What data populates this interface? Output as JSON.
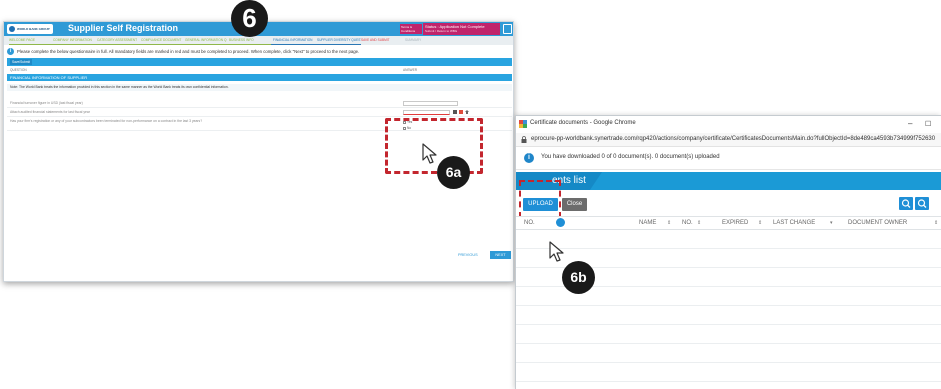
{
  "callouts": {
    "step_badge": "6",
    "label_a": "6a",
    "label_b": "6b"
  },
  "left_window": {
    "logo_text": "WORLD BANK GROUP",
    "title": "Supplier Self Registration",
    "terms_label": "Terms & Conditions",
    "status_text": "Status : Application Not Complete",
    "status_subtext": "Submit / Return to WBG",
    "steps": [
      {
        "label": "Welcome Page",
        "state": "done"
      },
      {
        "label": "Company Information",
        "state": "done"
      },
      {
        "label": "Category Assessment",
        "state": "done"
      },
      {
        "label": "Compliance Document",
        "state": "done"
      },
      {
        "label": "General Information Q",
        "state": "done"
      },
      {
        "label": "Business Info",
        "state": "done"
      },
      {
        "label": "Financial Information",
        "state": "active"
      },
      {
        "label": "Supplier Diversity Questionnaire",
        "state": "active"
      },
      {
        "label": "Save and Submit",
        "state": "red"
      },
      {
        "label": "Summary",
        "state": "gray"
      }
    ],
    "info_text": "Please complete the below questionnaire in full. All mandatory fields are marked in red and must be completed to proceed. When complete, click \"Next\" to proceed to the next page.",
    "tab_label": "Save/Submit",
    "col_question": "QUESTION",
    "col_answer": "ANSWER",
    "section_title": "FINANCIAL INFORMATION OF SUPPLIER",
    "note": "Note: The World Bank treats the information provided in this section in the same manner as the World Bank treats its own confidential information.",
    "questions": [
      "Financial turnover figure in USD (last fiscal year)",
      "Attach audited financial statements for last fiscal year",
      "Has your firm's registration or any of your subcontractors been terminated for non-performance on a contract in the last 3 years?"
    ],
    "radio_options": [
      "Yes",
      "No"
    ],
    "previous_label": "PREVIOUS",
    "next_label": "NEXT"
  },
  "right_window": {
    "window_title": "Certificate documents - Google Chrome",
    "url": "eprocure-pp-worldbank.synertrade.com/rqp420/actions/company/certificate/CertificatesDocumentsMain.do?fullObjectId=8de489ca4593b734999f752630",
    "download_info": "You have downloaded 0 of 0 document(s). 0 document(s) uploaded",
    "list_tab_label": "ents list",
    "upload_label": "UPLOAD",
    "close_label": "Close",
    "columns": [
      "NO.",
      "NAME",
      "NO.",
      "EXPIRED",
      "LAST CHANGE",
      "DOCUMENT OWNER"
    ]
  },
  "colors": {
    "brand_blue": "#2f9ad6",
    "highlight_red": "#c3262e",
    "status_magenta": "#c0246b",
    "badge_black": "#1a1a1a"
  }
}
